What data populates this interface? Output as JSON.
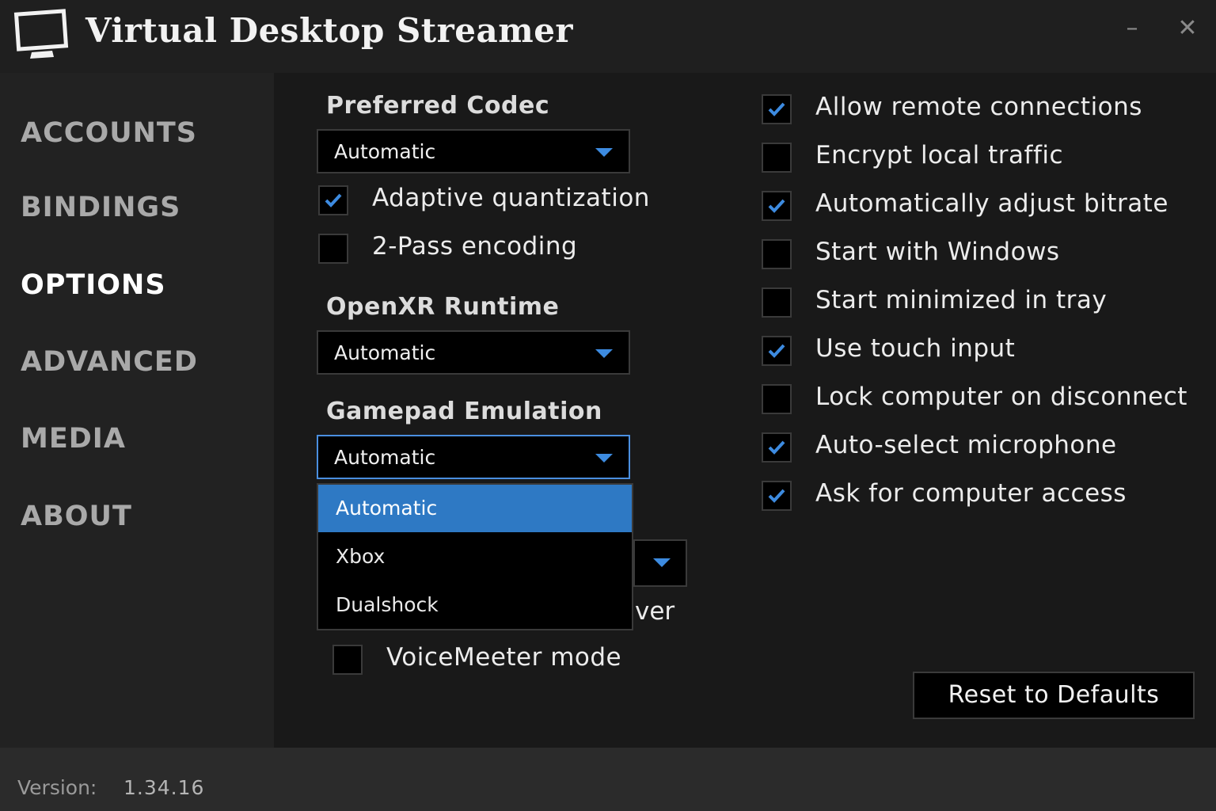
{
  "window": {
    "title": "Virtual Desktop Streamer",
    "minimize_label": "–",
    "close_label": "✕"
  },
  "sidebar": {
    "items": [
      {
        "label": "ACCOUNTS",
        "active": false
      },
      {
        "label": "BINDINGS",
        "active": false
      },
      {
        "label": "OPTIONS",
        "active": true
      },
      {
        "label": "ADVANCED",
        "active": false
      },
      {
        "label": "MEDIA",
        "active": false
      },
      {
        "label": "ABOUT",
        "active": false
      }
    ]
  },
  "options": {
    "codec": {
      "label": "Preferred Codec",
      "value": "Automatic"
    },
    "adaptive_quantization": {
      "label": "Adaptive quantization",
      "checked": true
    },
    "two_pass": {
      "label": "2-Pass encoding",
      "checked": false
    },
    "openxr": {
      "label": "OpenXR Runtime",
      "value": "Automatic"
    },
    "gamepad": {
      "label": "Gamepad Emulation",
      "value": "Automatic",
      "options": [
        "Automatic",
        "Xbox",
        "Dualshock"
      ],
      "selected_index": 0
    },
    "obscured_text": "ver",
    "voicemeeter": {
      "label": "VoiceMeeter mode",
      "checked": false
    },
    "right_checks": [
      {
        "label": "Allow remote connections",
        "checked": true
      },
      {
        "label": "Encrypt local traffic",
        "checked": false
      },
      {
        "label": "Automatically adjust bitrate",
        "checked": true
      },
      {
        "label": "Start with Windows",
        "checked": false
      },
      {
        "label": "Start minimized in tray",
        "checked": false
      },
      {
        "label": "Use touch input",
        "checked": true
      },
      {
        "label": "Lock computer on disconnect",
        "checked": false
      },
      {
        "label": "Auto-select microphone",
        "checked": true
      },
      {
        "label": "Ask for computer access",
        "checked": true
      }
    ],
    "reset_label": "Reset to Defaults"
  },
  "footer": {
    "version_label": "Version:",
    "version_value": "1.34.16"
  },
  "colors": {
    "accent": "#2e79c4",
    "check": "#3d8be0",
    "background": "#191919"
  }
}
